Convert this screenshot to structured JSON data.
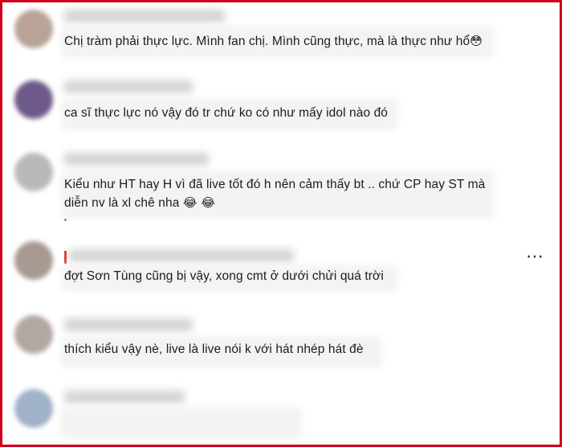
{
  "comments": [
    {
      "text": "Chị tràm phải thực lực. Mình fan chị. Mình cũng thực, mà là thực như hổ",
      "emoji": "😳",
      "avatar_color": "#b8a396"
    },
    {
      "text": "ca sĩ thực lực nó vậy đó tr chứ ko có như mấy idol nào đó",
      "emoji": "",
      "avatar_color": "#6d5a8a"
    },
    {
      "text_line1": "Kiểu như HT hay H vì đã live tốt đó h nên cảm thấy bt .. chứ CP hay ST mà",
      "text_line2": "diễn nv là xl chê nha",
      "emoji": "😂 😂",
      "avatar_color": "#b9b9b9"
    },
    {
      "text": "đợt Sơn Tùng cũng bị vậy, xong cmt ở dưới chửi quá trời",
      "emoji": "",
      "avatar_color": "#a89a92"
    },
    {
      "text": "thích kiểu vậy nè, live là live nói k với hát nhép hát đè",
      "emoji": "",
      "avatar_color": "#b3a7a2"
    },
    {
      "avatar_color": "#9fb2c9"
    }
  ],
  "more_icon": "⋯",
  "border_color": "#d0021b"
}
